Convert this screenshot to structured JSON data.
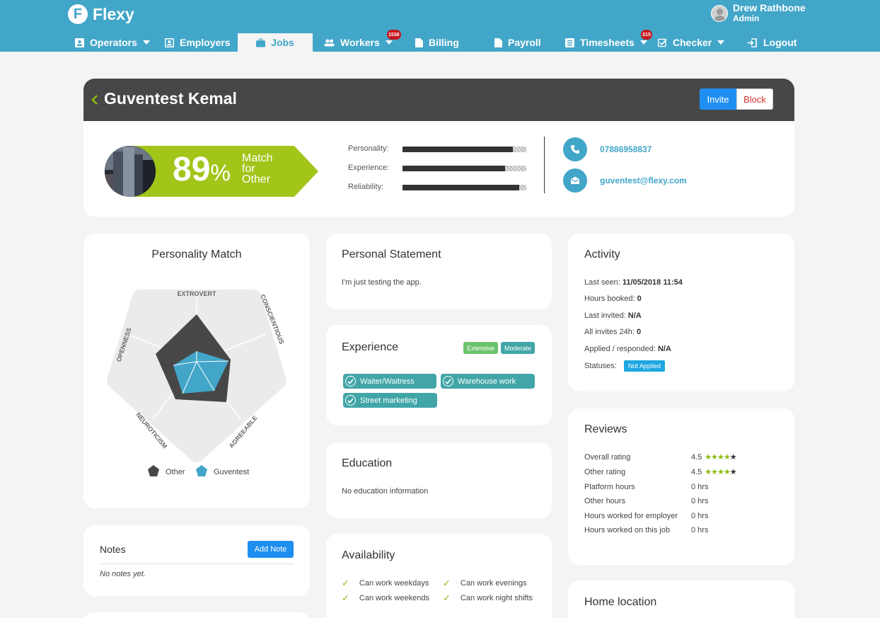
{
  "app": {
    "name": "Flexy",
    "logo_letter": "F"
  },
  "user": {
    "name": "Drew Rathbone",
    "role": "Admin"
  },
  "nav": [
    {
      "label": "Operators",
      "icon": "id-card-icon"
    },
    {
      "label": "Employers",
      "icon": "id-badge-icon"
    },
    {
      "label": "Jobs",
      "icon": "briefcase-icon"
    },
    {
      "label": "Workers",
      "icon": "users-icon",
      "badge": "1538"
    },
    {
      "label": "Billing",
      "icon": "file-icon"
    },
    {
      "label": "Payroll",
      "icon": "file-icon"
    },
    {
      "label": "Timesheets",
      "icon": "list-icon",
      "badge": "215"
    },
    {
      "label": "Checker",
      "icon": "check-square-icon"
    },
    {
      "label": "Logout",
      "icon": "logout-icon"
    }
  ],
  "profile": {
    "name": "Guventest Kemal",
    "invite_label": "Invite",
    "block_label": "Block",
    "match_percent": "89",
    "percent_sign": "%",
    "match_text": [
      "Match",
      "for",
      "Other"
    ],
    "bars": [
      {
        "label": "Personality:",
        "value": 0.89
      },
      {
        "label": "Experience:",
        "value": 0.83
      },
      {
        "label": "Reliability:",
        "value": 0.94
      }
    ],
    "phone": "07886958837",
    "email": "guventest@flexy.com"
  },
  "personality": {
    "title": "Personality Match",
    "axes": [
      "EXTROVERT",
      "CONSCIENTIOUS",
      "AGREEABLE",
      "NEUROTICISM",
      "OPENNESS"
    ],
    "legend": [
      {
        "label": "Other",
        "color": "#474747"
      },
      {
        "label": "Guventest",
        "color": "#42a6c9"
      }
    ]
  },
  "notes": {
    "title": "Notes",
    "add_label": "Add Note",
    "empty": "No notes yet."
  },
  "statement": {
    "title": "Personal Statement",
    "text": "I'm just testing the app."
  },
  "experience": {
    "title": "Experience",
    "legend": [
      {
        "label": "Extensive",
        "color": "#6cc36c"
      },
      {
        "label": "Moderate",
        "color": "#42a6a8"
      }
    ],
    "items": [
      "Waiter/Waitress",
      "Warehouse work",
      "Street marketing"
    ]
  },
  "education": {
    "title": "Education",
    "text": "No education information"
  },
  "availability": {
    "title": "Availability",
    "items": [
      "Can work weekdays",
      "Can work evenings",
      "Can work weekends",
      "Can work night shifts"
    ]
  },
  "activity": {
    "title": "Activity",
    "rows": [
      {
        "label": "Last seen:",
        "value": "11/05/2018 11:54"
      },
      {
        "label": "Hours booked:",
        "value": "0"
      },
      {
        "label": "Last invited:",
        "value": "N/A"
      },
      {
        "label": "All invites 24h:",
        "value": "0"
      },
      {
        "label": "Applied / responded:",
        "value": "N/A"
      }
    ],
    "status_label": "Statuses:",
    "status_value": "Not Applied"
  },
  "reviews": {
    "title": "Reviews",
    "rows": [
      {
        "label": "Overall rating",
        "value": "4.5",
        "stars": 4.5
      },
      {
        "label": "Other rating",
        "value": "4.5",
        "stars": 4.5
      },
      {
        "label": "Platform hours",
        "value": "0 hrs"
      },
      {
        "label": "Other hours",
        "value": "0 hrs"
      },
      {
        "label": "Hours worked for employer",
        "value": "0 hrs"
      },
      {
        "label": "Hours worked on this job",
        "value": "0 hrs"
      }
    ]
  },
  "location": {
    "title": "Home location"
  },
  "colors": {
    "brand": "#42a6c9",
    "accent_green": "#8dbb12",
    "button_blue": "#1e8ff0",
    "dark": "#474747"
  }
}
